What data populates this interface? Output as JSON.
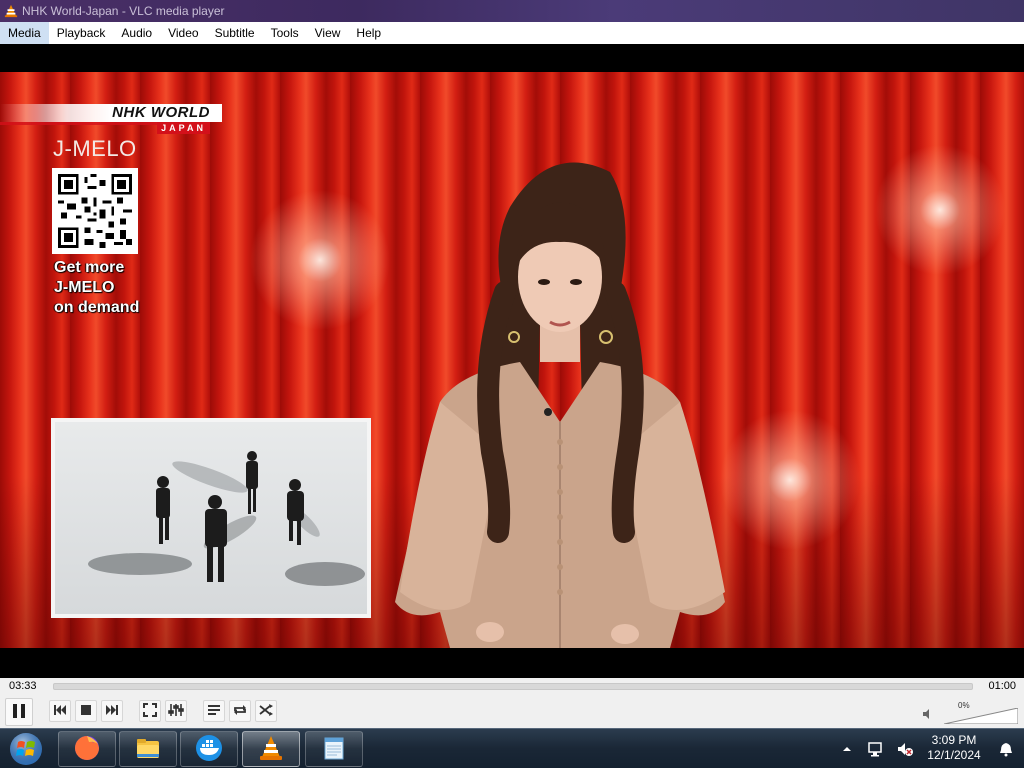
{
  "window": {
    "title": "NHK World-Japan - VLC media player"
  },
  "menu": {
    "items": [
      {
        "label": "Media",
        "active": true
      },
      {
        "label": "Playback"
      },
      {
        "label": "Audio"
      },
      {
        "label": "Video"
      },
      {
        "label": "Subtitle"
      },
      {
        "label": "Tools"
      },
      {
        "label": "View"
      },
      {
        "label": "Help"
      }
    ]
  },
  "video": {
    "logo_text": "NHK WORLD",
    "logo_subtext": "JAPAN",
    "show_title": "J-MELO",
    "promo_lines": [
      "Get more",
      "J-MELO",
      "on demand"
    ]
  },
  "playback": {
    "elapsed": "03:33",
    "total": "01:00",
    "progress": 0.0
  },
  "controls": {
    "volume_percent": "0%",
    "icons": [
      "pause-icon",
      "previous-icon",
      "stop-icon",
      "next-icon",
      "fullscreen-icon",
      "extended-settings-icon",
      "playlist-icon",
      "loop-icon",
      "shuffle-icon",
      "speaker-icon"
    ]
  },
  "taskbar": {
    "apps": [
      "firefox-icon",
      "file-explorer-icon",
      "docker-icon",
      "vlc-icon",
      "notepad-icon"
    ],
    "active_app": "vlc-icon",
    "time": "3:09 PM",
    "date": "12/1/2024"
  },
  "colors": {
    "seek_accent": "#ff8c00",
    "titlebar": "#4a2f67",
    "curtain_red": "#e8321c"
  }
}
